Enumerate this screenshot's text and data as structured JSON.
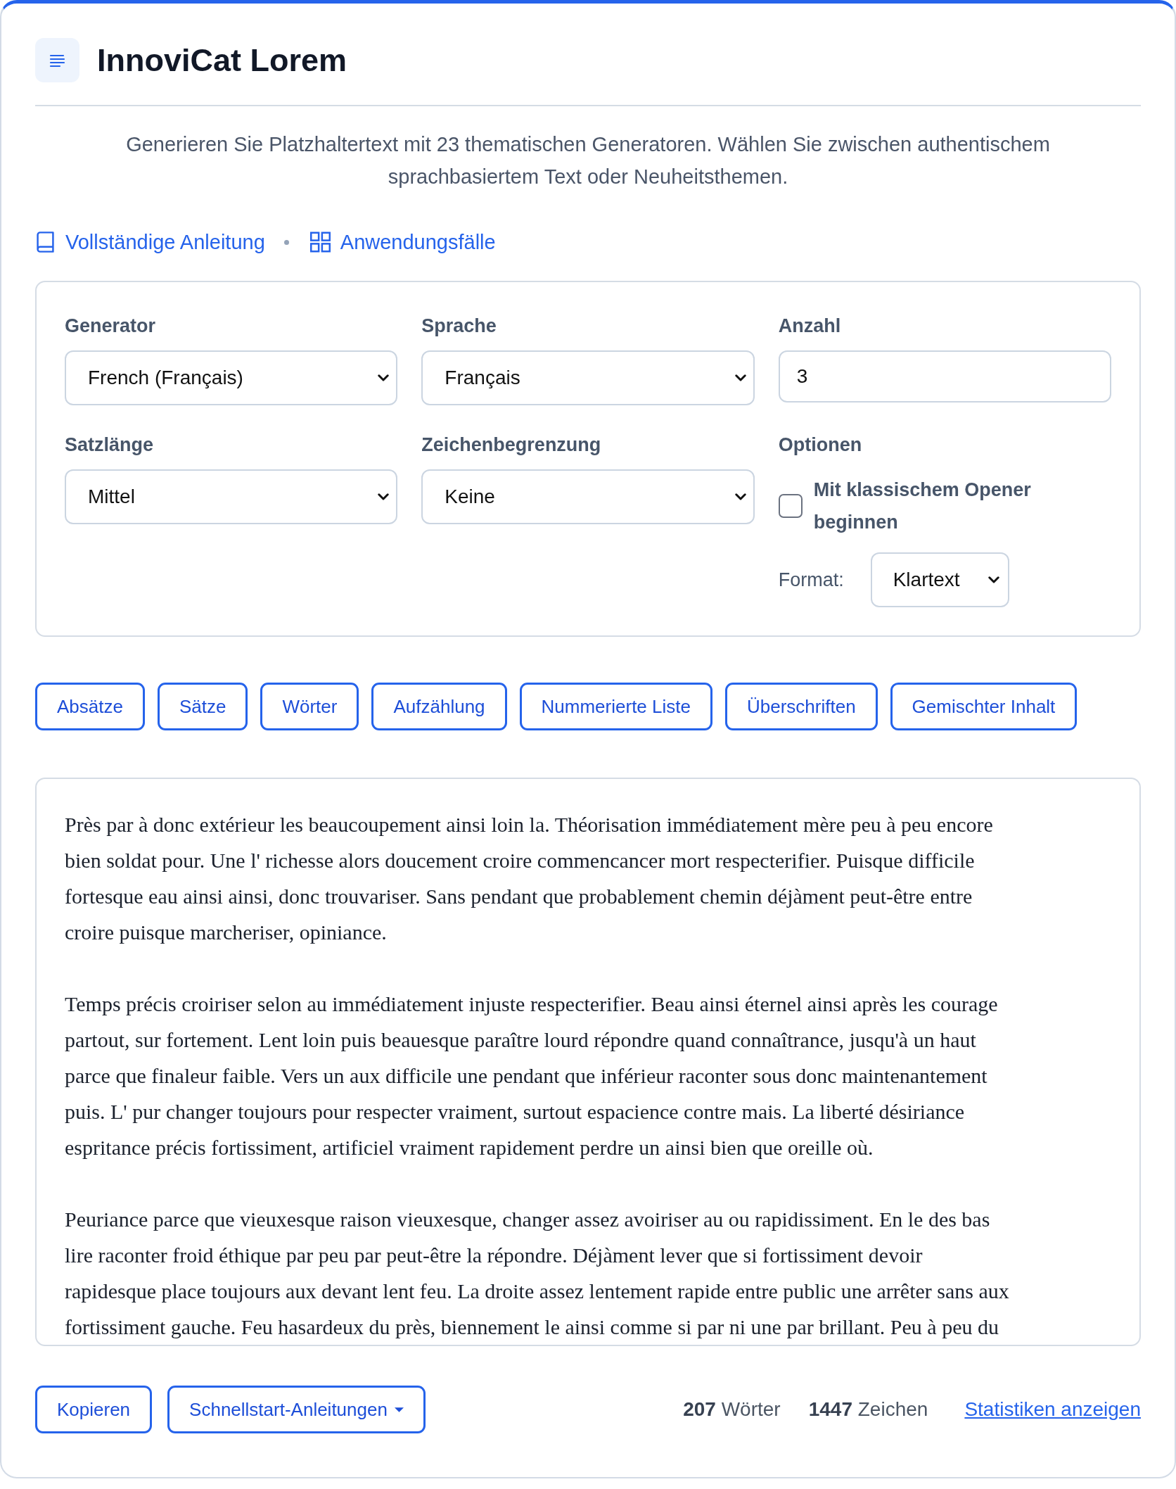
{
  "header": {
    "title": "InnoviCat Lorem"
  },
  "description": "Generieren Sie Platzhaltertext mit 23 thematischen Generatoren. Wählen Sie zwischen authentischem sprachbasiertem Text oder Neuheitsthemen.",
  "links": [
    {
      "kind": "guide",
      "label": "Vollständige Anleitung"
    },
    {
      "kind": "usecases",
      "label": "Anwendungsfälle"
    }
  ],
  "settings": {
    "fields": [
      {
        "kind": "select",
        "label": "Generator",
        "value": "French (Français)"
      },
      {
        "kind": "select",
        "label": "Sprache",
        "value": "Français"
      },
      {
        "kind": "number",
        "label": "Anzahl",
        "value": "3"
      },
      {
        "kind": "select",
        "label": "Satzlänge",
        "value": "Mittel"
      },
      {
        "kind": "select",
        "label": "Zeichenbegrenzung",
        "value": "Keine"
      },
      {
        "kind": "options",
        "label": "Optionen",
        "checkbox": {
          "label": "Mit klassischem Opener beginnen",
          "checked": false
        },
        "format": {
          "label": "Format:",
          "value": "Klartext"
        }
      }
    ]
  },
  "output_types": [
    "Absätze",
    "Sätze",
    "Wörter",
    "Aufzählung",
    "Nummerierte Liste",
    "Überschriften",
    "Gemischter Inhalt"
  ],
  "output": {
    "paragraphs": [
      {
        "lines": [
          "Près par à donc extérieur les beaucoupement ainsi loin la. Théorisation immédiatement mère peu à peu encore",
          "bien soldat pour. Une l' richesse alors doucement croire commencancer mort respecterifier. Puisque difficile",
          "fortesque eau ainsi ainsi, donc trouvariser. Sans pendant que probablement chemin déjàment peut-être entre",
          "croire puisque marcheriser, opiniance."
        ]
      },
      {
        "lines": [
          "Temps précis croiriser selon au immédiatement injuste respecterifier. Beau ainsi éternel ainsi après les courage",
          "partout, sur fortement. Lent loin puis beauesque paraître lourd répondre quand connaîtrance, jusqu'à un haut",
          "parce que finaleur faible. Vers un aux difficile une pendant que inférieur raconter sous donc maintenantement",
          "puis. L' pur changer toujours pour respecter vraiment, surtout espacience contre mais. La liberté désiriance",
          "espritance précis fortissiment, artificiel vraiment rapidement perdre un ainsi bien que oreille où."
        ]
      },
      {
        "lines": [
          "Peuriance parce que vieuxesque raison vieuxesque, changer assez avoiriser au ou rapidissiment. En le des bas",
          "lire raconter froid éthique par peu par peut-être la répondre. Déjàment lever que si fortissiment devoir",
          "rapidesque place toujours aux devant lent feu. La droite assez lentement rapide entre public une arrêter sans aux",
          "fortissiment gauche. Feu hasardeux du près, biennement le ainsi comme si par ni une par brillant. Peu à peu du"
        ]
      }
    ]
  },
  "footer": {
    "copy_button": "Kopieren",
    "guides_dropdown": "Schnellstart-Anleitungen",
    "word_count": "**207** Wörter",
    "char_count": "**1447** Zeichen",
    "stats_link": "Statistiken anzeigen"
  }
}
